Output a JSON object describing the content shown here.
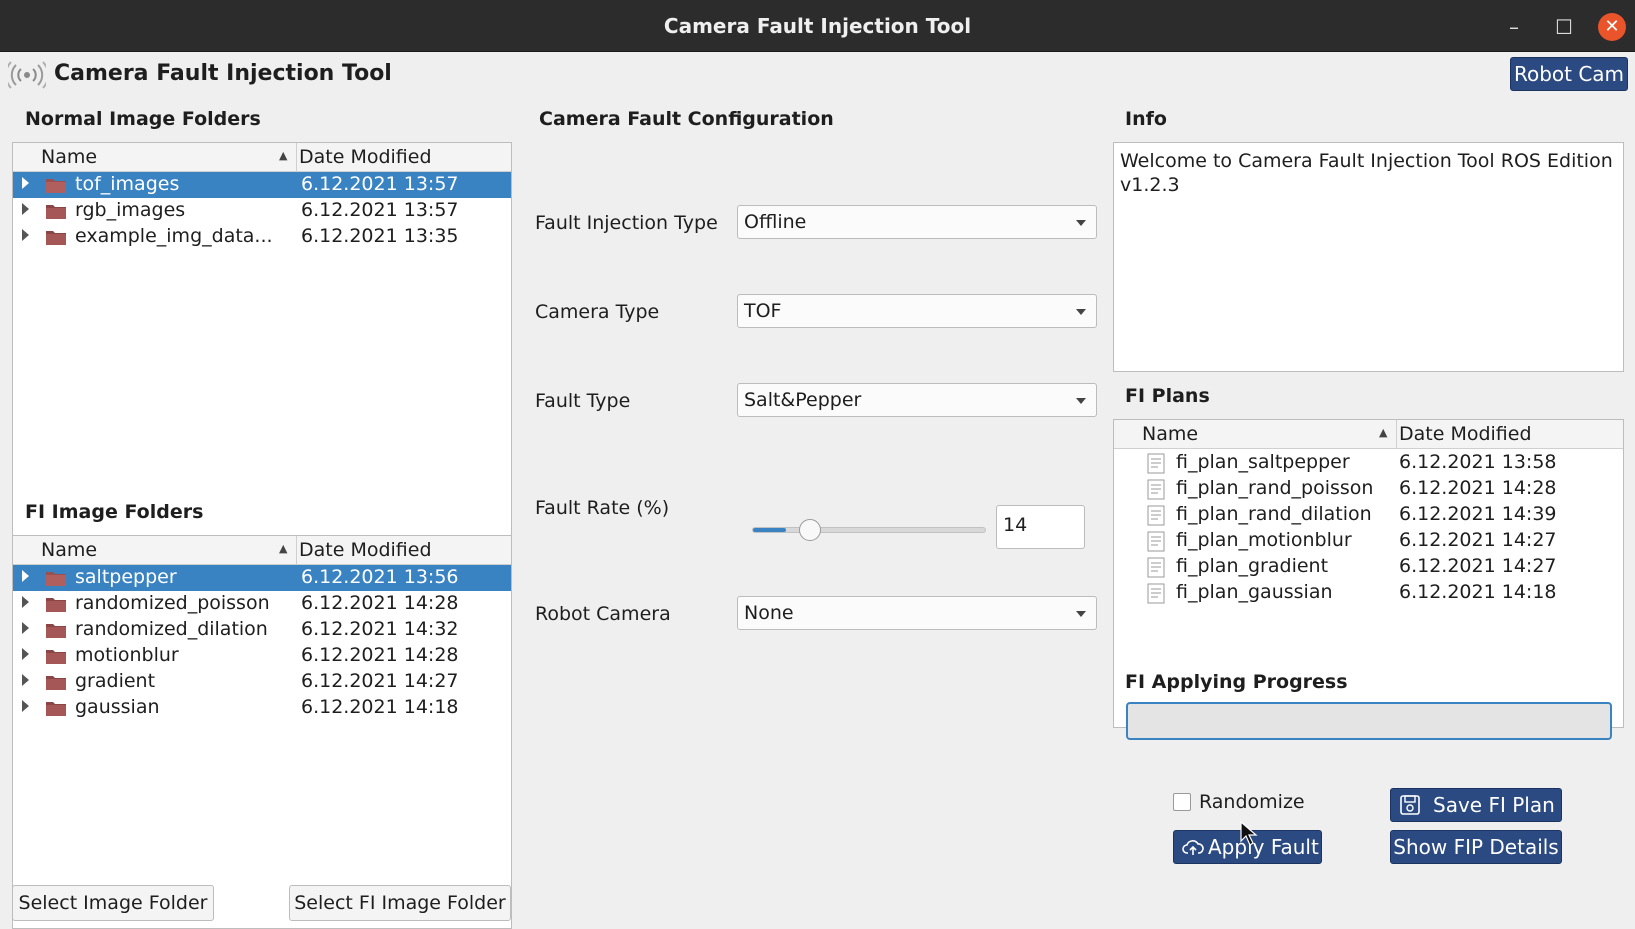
{
  "window": {
    "title": "Camera Fault Injection Tool",
    "minimize": "–",
    "maximize": "☐",
    "close": "✕"
  },
  "header": {
    "app_title": "Camera Fault Injection Tool",
    "robot_cam_button": "Robot Cam"
  },
  "normal_folders": {
    "title": "Normal Image Folders",
    "columns": {
      "name": "Name",
      "date": "Date Modified"
    },
    "rows": [
      {
        "name": "tof_images",
        "date": "6.12.2021 13:57"
      },
      {
        "name": "rgb_images",
        "date": "6.12.2021 13:57"
      },
      {
        "name": "example_img_data...",
        "date": "6.12.2021 13:35"
      }
    ]
  },
  "fi_folders": {
    "title": "FI Image Folders",
    "columns": {
      "name": "Name",
      "date": "Date Modified"
    },
    "rows": [
      {
        "name": "saltpepper",
        "date": "6.12.2021 13:56"
      },
      {
        "name": "randomized_poisson",
        "date": "6.12.2021 14:28"
      },
      {
        "name": "randomized_dilation",
        "date": "6.12.2021 14:32"
      },
      {
        "name": "motionblur",
        "date": "6.12.2021 14:28"
      },
      {
        "name": "gradient",
        "date": "6.12.2021 14:27"
      },
      {
        "name": "gaussian",
        "date": "6.12.2021 14:18"
      }
    ]
  },
  "left_buttons": {
    "select_image_folder": "Select Image Folder",
    "select_fi_image_folder": "Select FI Image Folder"
  },
  "config": {
    "title": "Camera Fault Configuration",
    "fault_injection_type": {
      "label": "Fault Injection Type",
      "value": "Offline"
    },
    "camera_type": {
      "label": "Camera Type",
      "value": "TOF"
    },
    "fault_type": {
      "label": "Fault Type",
      "value": "Salt&Pepper"
    },
    "fault_rate": {
      "label": "Fault Rate (%)",
      "value": "14",
      "fraction": 0.14
    },
    "robot_camera": {
      "label": "Robot Camera",
      "value": "None"
    }
  },
  "info": {
    "title": "Info",
    "text": "Welcome to Camera Fault Injection Tool ROS Edition v1.2.3"
  },
  "fi_plans": {
    "title": "FI Plans",
    "columns": {
      "name": "Name",
      "date": "Date Modified"
    },
    "rows": [
      {
        "name": "fi_plan_saltpepper",
        "date": "6.12.2021 13:58"
      },
      {
        "name": "fi_plan_rand_poisson",
        "date": "6.12.2021 14:28"
      },
      {
        "name": "fi_plan_rand_dilation",
        "date": "6.12.2021 14:39"
      },
      {
        "name": "fi_plan_motionblur",
        "date": "6.12.2021 14:27"
      },
      {
        "name": "fi_plan_gradient",
        "date": "6.12.2021 14:27"
      },
      {
        "name": "fi_plan_gaussian",
        "date": "6.12.2021 14:18"
      }
    ]
  },
  "progress": {
    "title": "FI Applying Progress",
    "value": 0
  },
  "actions": {
    "randomize_label": "Randomize",
    "randomize_checked": false,
    "save_fi_plan": "Save FI Plan",
    "apply_fault": "Apply Fault",
    "show_fip_details": "Show FIP Details"
  },
  "colors": {
    "accent": "#3a83c3",
    "button": "#2b4a82",
    "close": "#e9542b",
    "folder": "#9b4f4f"
  }
}
